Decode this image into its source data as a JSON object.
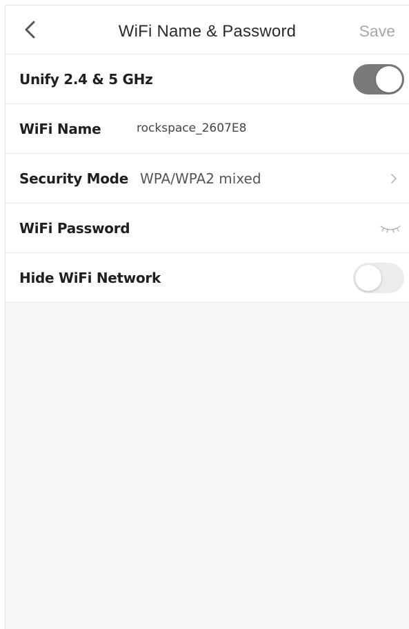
{
  "header": {
    "back_icon": "chevron-left-icon",
    "title": "WiFi Name & Password",
    "save_label": "Save"
  },
  "settings": {
    "unify": {
      "label": "Unify 2.4 & 5 GHz",
      "enabled": true
    },
    "wifi_name": {
      "label": "WiFi Name",
      "value": "rockspace_2607E8"
    },
    "security_mode": {
      "label": "Security Mode",
      "value": "WPA/WPA2 mixed",
      "icon": "chevron-right-icon"
    },
    "wifi_password": {
      "label": "WiFi Password",
      "icon": "eye-closed-icon"
    },
    "hide_network": {
      "label": "Hide WiFi Network",
      "enabled": false
    }
  },
  "colors": {
    "toggle_on": "#7a7a7a",
    "toggle_off": "#ececec",
    "save_disabled": "#a8a8a8",
    "background": "#f6f6f6"
  }
}
